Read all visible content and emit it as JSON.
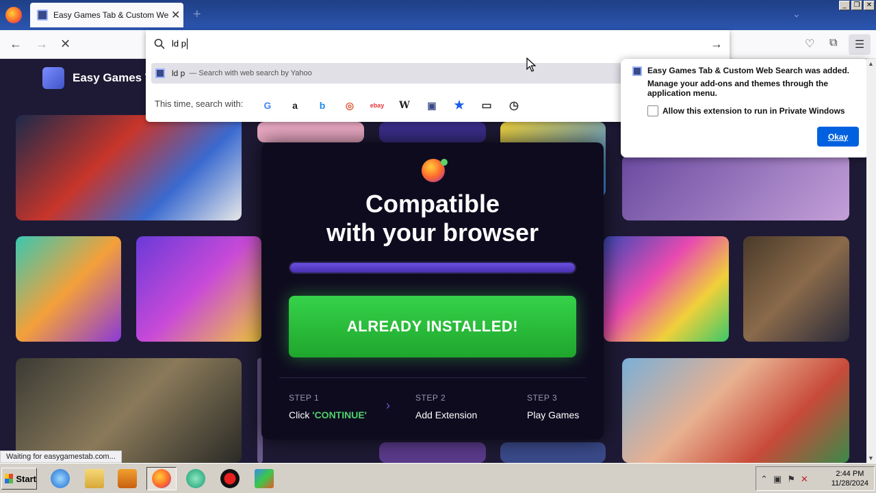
{
  "browser": {
    "tab_title": "Easy Games Tab & Custom Web Se",
    "tab_close": "✕",
    "new_tab": "+",
    "window_buttons": [
      "_",
      "❐",
      "✕"
    ]
  },
  "navbar": {
    "back": "←",
    "forward": "→",
    "stop": "✕",
    "url_text": "ld p",
    "go": "→",
    "suggestion_query": "ld p",
    "suggestion_hint": "— Search with web search by Yahoo",
    "this_time_label": "This time, search with:",
    "engines": [
      "G",
      "a",
      "b",
      "◎",
      "ebay",
      "W",
      "▣",
      "★",
      "▭",
      "◷"
    ]
  },
  "site": {
    "name": "Easy Games T"
  },
  "modal": {
    "heading_line1": "Compatible",
    "heading_line2": "with your browser",
    "progress": 1.0,
    "button_label": "ALREADY INSTALLED!",
    "steps": [
      {
        "label": "STEP 1",
        "prefix": "Click ",
        "highlight": "'CONTINUE'"
      },
      {
        "label": "STEP 2",
        "text": "Add Extension"
      },
      {
        "label": "STEP 3",
        "text": "Play Games"
      }
    ],
    "step_arrow": "›"
  },
  "popup": {
    "title": "Easy Games Tab & Custom Web Search was added.",
    "message": "Manage your add-ons and themes through the application menu.",
    "checkbox_label": "Allow this extension to run in Private Windows",
    "checkbox_checked": false,
    "okay_label": "Okay"
  },
  "status_bar": "Waiting for easygamestab.com...",
  "taskbar": {
    "start_label": "Start",
    "time": "2:44 PM",
    "date": "11/28/2024"
  },
  "colors": {
    "accent_green": "#36d24a",
    "popup_button": "#0061e0",
    "progress_fill": "#6a4fe0"
  }
}
